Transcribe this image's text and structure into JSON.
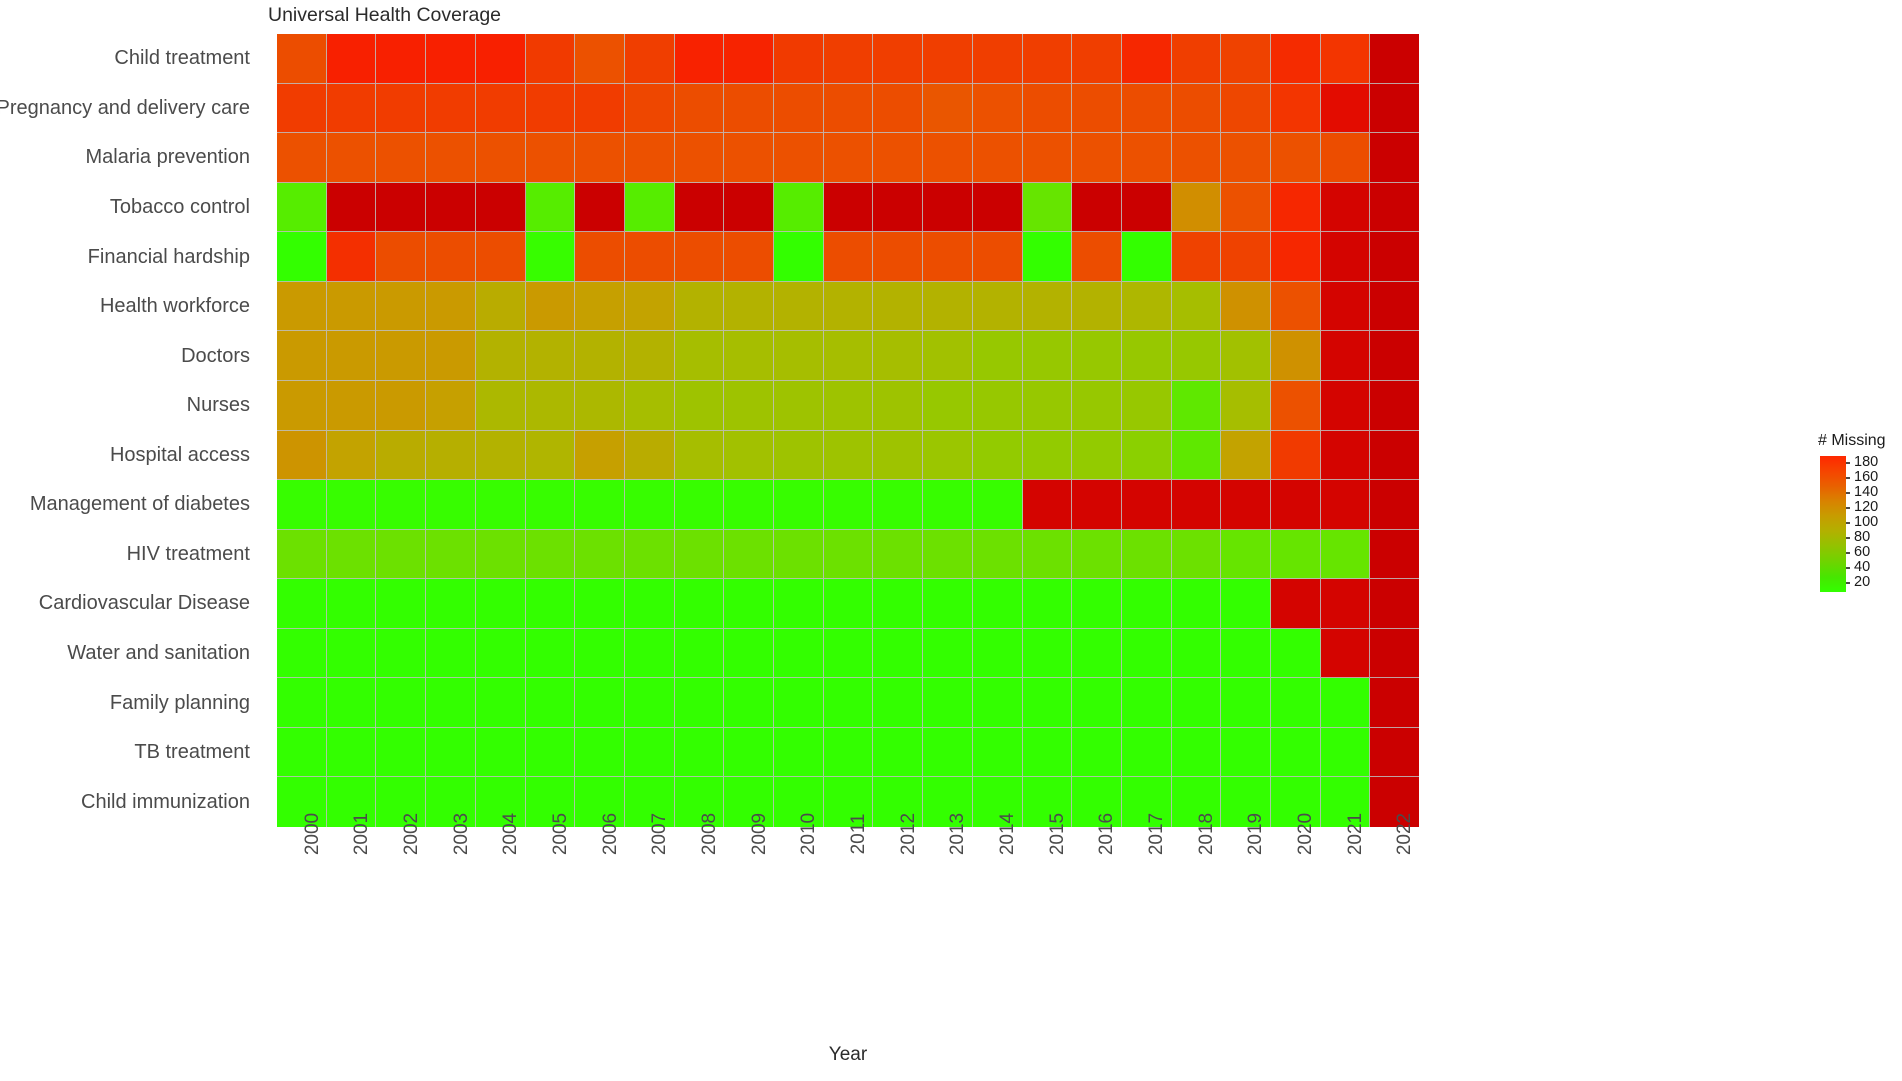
{
  "chart": {
    "title": "Universal Health Coverage",
    "xlabel": "Year",
    "ylabel": ""
  },
  "legend": {
    "title": "# Missing",
    "ticks": [
      "180",
      "160",
      "140",
      "120",
      "100",
      "80",
      "60",
      "40",
      "20"
    ],
    "tick_values": [
      180,
      160,
      140,
      120,
      100,
      80,
      60,
      40,
      20
    ],
    "low_color": "#33ff00",
    "mid_color": "#b3b000",
    "high_color": "#ff2800",
    "max_color": "#cc0000"
  },
  "chart_data": {
    "type": "heatmap",
    "title": "Universal Health Coverage",
    "xlabel": "Year",
    "ylabel": "",
    "colorbar_label": "# Missing",
    "grid": true,
    "legend_position": "right",
    "zlim": [
      0,
      195
    ],
    "x": [
      "2000",
      "2001",
      "2002",
      "2003",
      "2004",
      "2005",
      "2006",
      "2007",
      "2008",
      "2009",
      "2010",
      "2011",
      "2012",
      "2013",
      "2014",
      "2015",
      "2016",
      "2017",
      "2018",
      "2019",
      "2020",
      "2021",
      "2022"
    ],
    "y": [
      "Child treatment",
      "Pregnancy and delivery care",
      "Malaria prevention",
      "Tobacco control",
      "Financial hardship",
      "Health workforce",
      "Doctors",
      "Nurses",
      "Hospital access",
      "Management of diabetes",
      "HIV treatment",
      "Cardiovascular Disease",
      "Water and sanitation",
      "Family planning",
      "TB treatment",
      "Child immunization"
    ],
    "z": [
      [
        152,
        176,
        176,
        176,
        176,
        162,
        150,
        160,
        175,
        174,
        162,
        160,
        160,
        160,
        160,
        160,
        160,
        172,
        160,
        158,
        170,
        165,
        193
      ],
      [
        161,
        161,
        161,
        161,
        161,
        161,
        161,
        155,
        152,
        152,
        152,
        152,
        152,
        147,
        150,
        152,
        152,
        152,
        152,
        155,
        165,
        186,
        193
      ],
      [
        150,
        150,
        150,
        150,
        150,
        150,
        150,
        150,
        150,
        150,
        150,
        150,
        150,
        150,
        150,
        150,
        150,
        150,
        150,
        150,
        150,
        152,
        193
      ],
      [
        36,
        193,
        193,
        193,
        193,
        36,
        193,
        36,
        193,
        193,
        36,
        193,
        193,
        193,
        193,
        44,
        193,
        193,
        112,
        150,
        172,
        190,
        193
      ],
      [
        20,
        168,
        152,
        152,
        152,
        22,
        152,
        152,
        152,
        152,
        20,
        152,
        152,
        152,
        152,
        20,
        152,
        20,
        158,
        158,
        172,
        190,
        193
      ],
      [
        104,
        104,
        104,
        104,
        92,
        104,
        100,
        98,
        88,
        88,
        88,
        88,
        88,
        88,
        88,
        88,
        88,
        85,
        80,
        110,
        150,
        190,
        193
      ],
      [
        104,
        104,
        104,
        104,
        88,
        88,
        88,
        88,
        80,
        80,
        80,
        80,
        80,
        78,
        72,
        72,
        72,
        72,
        72,
        78,
        110,
        190,
        193
      ],
      [
        104,
        104,
        104,
        100,
        84,
        84,
        84,
        80,
        76,
        76,
        76,
        76,
        76,
        72,
        72,
        72,
        72,
        72,
        40,
        80,
        150,
        190,
        193
      ],
      [
        108,
        98,
        92,
        90,
        88,
        86,
        100,
        92,
        80,
        78,
        76,
        76,
        76,
        74,
        70,
        70,
        70,
        66,
        40,
        98,
        162,
        190,
        193
      ],
      [
        22,
        22,
        22,
        22,
        22,
        22,
        22,
        22,
        22,
        22,
        22,
        22,
        22,
        22,
        22,
        190,
        190,
        190,
        190,
        190,
        190,
        190,
        193
      ],
      [
        48,
        48,
        48,
        48,
        48,
        48,
        48,
        48,
        48,
        48,
        48,
        48,
        48,
        48,
        48,
        48,
        48,
        48,
        48,
        44,
        44,
        44,
        193
      ],
      [
        20,
        20,
        20,
        20,
        20,
        20,
        20,
        20,
        20,
        20,
        20,
        20,
        20,
        20,
        20,
        20,
        20,
        20,
        20,
        20,
        190,
        190,
        193
      ],
      [
        20,
        20,
        20,
        20,
        20,
        20,
        20,
        20,
        20,
        20,
        20,
        20,
        20,
        20,
        20,
        20,
        20,
        20,
        20,
        20,
        20,
        190,
        193
      ],
      [
        20,
        20,
        20,
        20,
        20,
        20,
        20,
        20,
        20,
        20,
        20,
        20,
        20,
        20,
        20,
        20,
        20,
        20,
        20,
        20,
        20,
        20,
        193
      ],
      [
        20,
        20,
        20,
        20,
        20,
        20,
        20,
        20,
        20,
        20,
        20,
        20,
        20,
        20,
        20,
        20,
        20,
        20,
        20,
        20,
        20,
        20,
        193
      ],
      [
        20,
        20,
        20,
        20,
        20,
        20,
        20,
        20,
        20,
        20,
        20,
        20,
        20,
        20,
        20,
        20,
        20,
        20,
        20,
        20,
        20,
        20,
        193
      ]
    ]
  }
}
